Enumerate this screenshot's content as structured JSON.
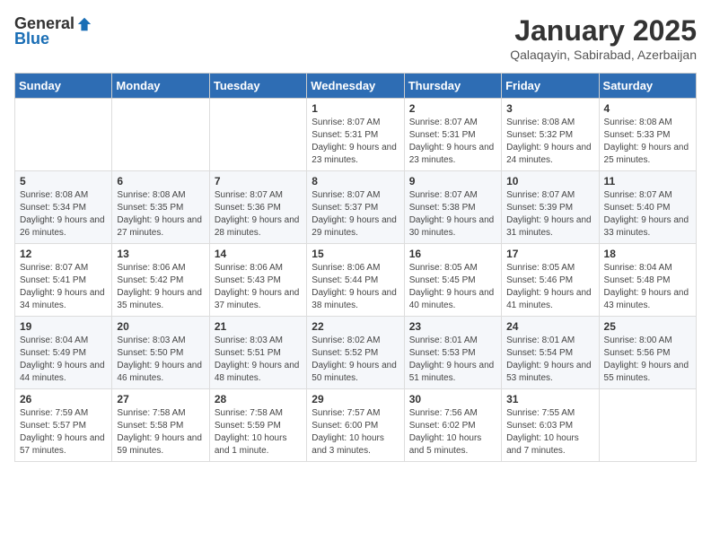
{
  "header": {
    "logo_general": "General",
    "logo_blue": "Blue",
    "month_title": "January 2025",
    "location": "Qalaqayin, Sabirabad, Azerbaijan"
  },
  "weekdays": [
    "Sunday",
    "Monday",
    "Tuesday",
    "Wednesday",
    "Thursday",
    "Friday",
    "Saturday"
  ],
  "weeks": [
    [
      {
        "day": "",
        "info": ""
      },
      {
        "day": "",
        "info": ""
      },
      {
        "day": "",
        "info": ""
      },
      {
        "day": "1",
        "info": "Sunrise: 8:07 AM\nSunset: 5:31 PM\nDaylight: 9 hours and 23 minutes."
      },
      {
        "day": "2",
        "info": "Sunrise: 8:07 AM\nSunset: 5:31 PM\nDaylight: 9 hours and 23 minutes."
      },
      {
        "day": "3",
        "info": "Sunrise: 8:08 AM\nSunset: 5:32 PM\nDaylight: 9 hours and 24 minutes."
      },
      {
        "day": "4",
        "info": "Sunrise: 8:08 AM\nSunset: 5:33 PM\nDaylight: 9 hours and 25 minutes."
      }
    ],
    [
      {
        "day": "5",
        "info": "Sunrise: 8:08 AM\nSunset: 5:34 PM\nDaylight: 9 hours and 26 minutes."
      },
      {
        "day": "6",
        "info": "Sunrise: 8:08 AM\nSunset: 5:35 PM\nDaylight: 9 hours and 27 minutes."
      },
      {
        "day": "7",
        "info": "Sunrise: 8:07 AM\nSunset: 5:36 PM\nDaylight: 9 hours and 28 minutes."
      },
      {
        "day": "8",
        "info": "Sunrise: 8:07 AM\nSunset: 5:37 PM\nDaylight: 9 hours and 29 minutes."
      },
      {
        "day": "9",
        "info": "Sunrise: 8:07 AM\nSunset: 5:38 PM\nDaylight: 9 hours and 30 minutes."
      },
      {
        "day": "10",
        "info": "Sunrise: 8:07 AM\nSunset: 5:39 PM\nDaylight: 9 hours and 31 minutes."
      },
      {
        "day": "11",
        "info": "Sunrise: 8:07 AM\nSunset: 5:40 PM\nDaylight: 9 hours and 33 minutes."
      }
    ],
    [
      {
        "day": "12",
        "info": "Sunrise: 8:07 AM\nSunset: 5:41 PM\nDaylight: 9 hours and 34 minutes."
      },
      {
        "day": "13",
        "info": "Sunrise: 8:06 AM\nSunset: 5:42 PM\nDaylight: 9 hours and 35 minutes."
      },
      {
        "day": "14",
        "info": "Sunrise: 8:06 AM\nSunset: 5:43 PM\nDaylight: 9 hours and 37 minutes."
      },
      {
        "day": "15",
        "info": "Sunrise: 8:06 AM\nSunset: 5:44 PM\nDaylight: 9 hours and 38 minutes."
      },
      {
        "day": "16",
        "info": "Sunrise: 8:05 AM\nSunset: 5:45 PM\nDaylight: 9 hours and 40 minutes."
      },
      {
        "day": "17",
        "info": "Sunrise: 8:05 AM\nSunset: 5:46 PM\nDaylight: 9 hours and 41 minutes."
      },
      {
        "day": "18",
        "info": "Sunrise: 8:04 AM\nSunset: 5:48 PM\nDaylight: 9 hours and 43 minutes."
      }
    ],
    [
      {
        "day": "19",
        "info": "Sunrise: 8:04 AM\nSunset: 5:49 PM\nDaylight: 9 hours and 44 minutes."
      },
      {
        "day": "20",
        "info": "Sunrise: 8:03 AM\nSunset: 5:50 PM\nDaylight: 9 hours and 46 minutes."
      },
      {
        "day": "21",
        "info": "Sunrise: 8:03 AM\nSunset: 5:51 PM\nDaylight: 9 hours and 48 minutes."
      },
      {
        "day": "22",
        "info": "Sunrise: 8:02 AM\nSunset: 5:52 PM\nDaylight: 9 hours and 50 minutes."
      },
      {
        "day": "23",
        "info": "Sunrise: 8:01 AM\nSunset: 5:53 PM\nDaylight: 9 hours and 51 minutes."
      },
      {
        "day": "24",
        "info": "Sunrise: 8:01 AM\nSunset: 5:54 PM\nDaylight: 9 hours and 53 minutes."
      },
      {
        "day": "25",
        "info": "Sunrise: 8:00 AM\nSunset: 5:56 PM\nDaylight: 9 hours and 55 minutes."
      }
    ],
    [
      {
        "day": "26",
        "info": "Sunrise: 7:59 AM\nSunset: 5:57 PM\nDaylight: 9 hours and 57 minutes."
      },
      {
        "day": "27",
        "info": "Sunrise: 7:58 AM\nSunset: 5:58 PM\nDaylight: 9 hours and 59 minutes."
      },
      {
        "day": "28",
        "info": "Sunrise: 7:58 AM\nSunset: 5:59 PM\nDaylight: 10 hours and 1 minute."
      },
      {
        "day": "29",
        "info": "Sunrise: 7:57 AM\nSunset: 6:00 PM\nDaylight: 10 hours and 3 minutes."
      },
      {
        "day": "30",
        "info": "Sunrise: 7:56 AM\nSunset: 6:02 PM\nDaylight: 10 hours and 5 minutes."
      },
      {
        "day": "31",
        "info": "Sunrise: 7:55 AM\nSunset: 6:03 PM\nDaylight: 10 hours and 7 minutes."
      },
      {
        "day": "",
        "info": ""
      }
    ]
  ]
}
